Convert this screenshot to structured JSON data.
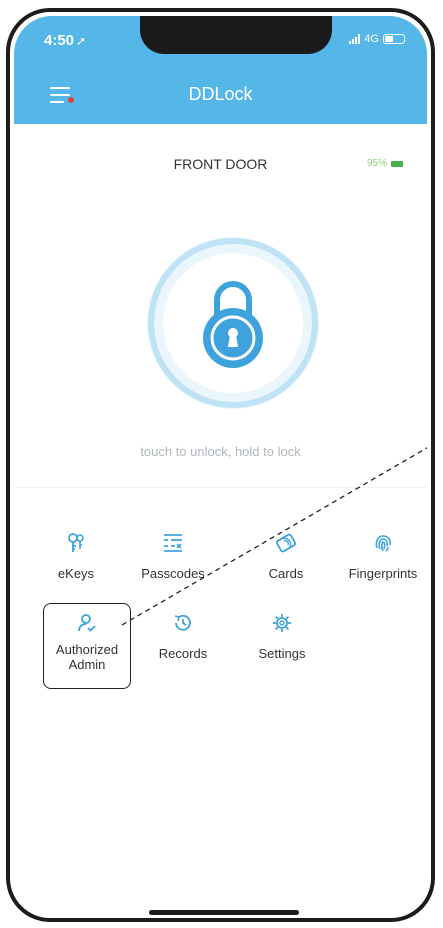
{
  "status_bar": {
    "time": "4:50",
    "network": "4G"
  },
  "header": {
    "title": "DDLock"
  },
  "lock": {
    "name": "FRONT DOOR",
    "battery": "95%",
    "hint": "touch to unlock, hold to lock"
  },
  "menu": [
    {
      "label": "eKeys",
      "icon": "ekeys-icon"
    },
    {
      "label": "Passcodes",
      "icon": "passcodes-icon"
    },
    {
      "label": "Cards",
      "icon": "cards-icon"
    },
    {
      "label": "Fingerprints",
      "icon": "fingerprint-icon"
    },
    {
      "label": "Authorized Admin",
      "icon": "authorized-admin-icon"
    },
    {
      "label": "Records",
      "icon": "records-icon"
    },
    {
      "label": "Settings",
      "icon": "settings-icon"
    }
  ],
  "colors": {
    "accent": "#55b6e8",
    "battery": "#49b04a"
  }
}
